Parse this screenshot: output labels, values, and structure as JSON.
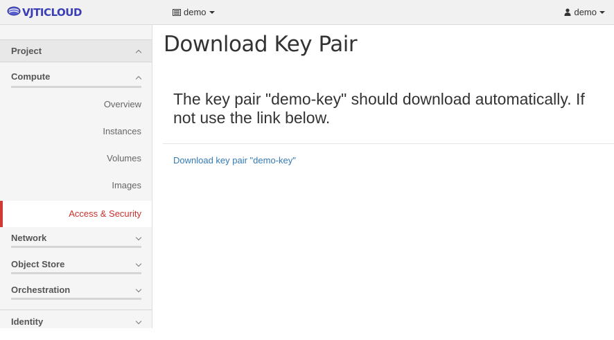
{
  "header": {
    "logo_text": "VJTICLOUD",
    "project_label": "demo",
    "user_label": "demo"
  },
  "sidebar": {
    "project": {
      "label": "Project"
    },
    "compute": {
      "label": "Compute",
      "items": [
        {
          "label": "Overview"
        },
        {
          "label": "Instances"
        },
        {
          "label": "Volumes"
        },
        {
          "label": "Images"
        },
        {
          "label": "Access & Security",
          "active": true
        }
      ]
    },
    "network": {
      "label": "Network"
    },
    "object_store": {
      "label": "Object Store"
    },
    "orchestration": {
      "label": "Orchestration"
    },
    "identity": {
      "label": "Identity"
    }
  },
  "main": {
    "title": "Download Key Pair",
    "message": "The key pair \"demo-key\" should download automatically. If not use the link below.",
    "download_link": "Download key pair \"demo-key\""
  },
  "colors": {
    "active_nav": "#c9302c",
    "link": "#337ab7",
    "logo": "#3b3fb5"
  }
}
